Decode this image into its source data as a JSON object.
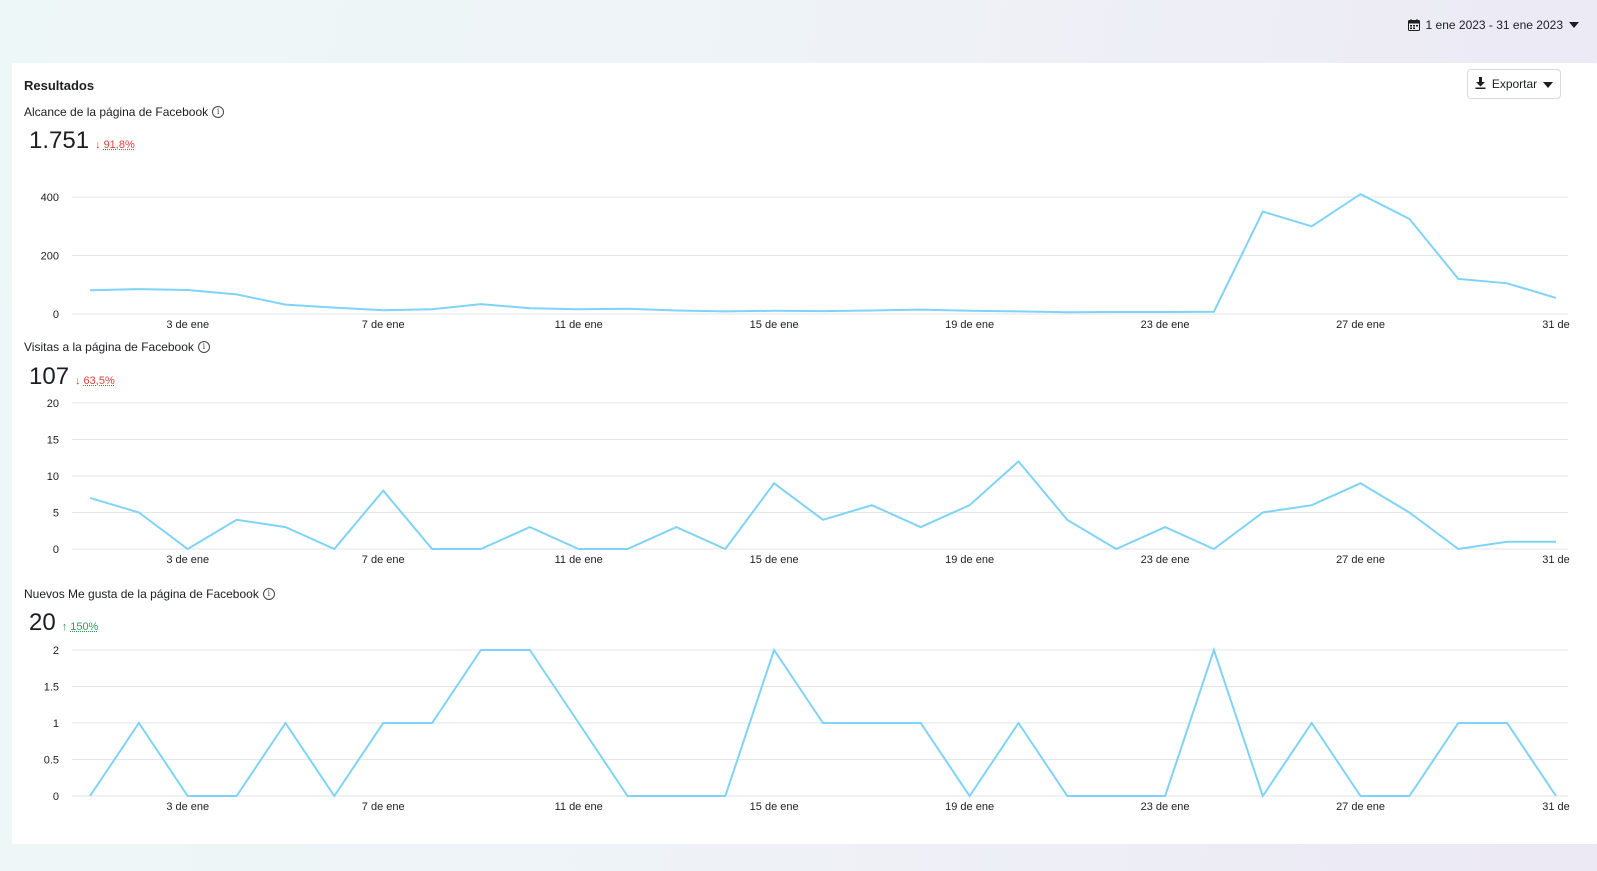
{
  "header": {
    "date_range_label": "1 ene 2023 - 31 ene 2023",
    "calendar_icon": "calendar-icon",
    "caret_icon": "caret-down-icon"
  },
  "results": {
    "title": "Resultados",
    "export_label": "Exportar",
    "export_icon": "download-icon"
  },
  "metrics": [
    {
      "label": "Alcance de la página de Facebook",
      "value": "1.751",
      "delta": "91,8%",
      "direction": "down"
    },
    {
      "label": "Visitas a la página de Facebook",
      "value": "107",
      "delta": "63,5%",
      "direction": "down"
    },
    {
      "label": "Nuevos Me gusta de la página de Facebook",
      "value": "20",
      "delta": "150%",
      "direction": "up"
    }
  ],
  "colors": {
    "line": "#7fd3f7",
    "grid": "#e4e6eb",
    "down": "#e0413b",
    "up": "#2f9e5a"
  },
  "chart_data": [
    {
      "type": "line",
      "name": "Alcance de la página de Facebook",
      "x": [
        1,
        2,
        3,
        4,
        5,
        6,
        7,
        8,
        9,
        10,
        11,
        12,
        13,
        14,
        15,
        16,
        17,
        18,
        19,
        20,
        21,
        22,
        23,
        24,
        25,
        26,
        27,
        28,
        29,
        30,
        31
      ],
      "values": [
        81,
        85,
        82,
        67,
        32,
        22,
        13,
        16,
        34,
        20,
        16,
        18,
        12,
        9,
        11,
        10,
        12,
        15,
        11,
        9,
        6,
        7,
        7,
        8,
        350,
        300,
        410,
        325,
        120,
        105,
        55
      ],
      "yticks": [
        "0",
        "200",
        "400"
      ],
      "ylim": [
        0,
        400
      ],
      "xtick_positions": [
        3,
        7,
        11,
        15,
        19,
        23,
        27,
        31
      ],
      "xtick_labels": [
        "3 de ene",
        "7 de ene",
        "11 de ene",
        "15 de ene",
        "19 de ene",
        "23 de ene",
        "27 de ene",
        "31 de"
      ]
    },
    {
      "type": "line",
      "name": "Visitas a la página de Facebook",
      "x": [
        1,
        2,
        3,
        4,
        5,
        6,
        7,
        8,
        9,
        10,
        11,
        12,
        13,
        14,
        15,
        16,
        17,
        18,
        19,
        20,
        21,
        22,
        23,
        24,
        25,
        26,
        27,
        28,
        29,
        30,
        31
      ],
      "values": [
        7,
        5,
        0,
        4,
        3,
        0,
        8,
        0,
        0,
        3,
        0,
        0,
        3,
        0,
        9,
        4,
        6,
        3,
        6,
        12,
        4,
        0,
        3,
        0,
        5,
        6,
        9,
        5,
        0,
        1,
        1
      ],
      "yticks": [
        "0",
        "5",
        "10",
        "15",
        "20"
      ],
      "ylim": [
        0,
        20
      ],
      "xtick_positions": [
        3,
        7,
        11,
        15,
        19,
        23,
        27,
        31
      ],
      "xtick_labels": [
        "3 de ene",
        "7 de ene",
        "11 de ene",
        "15 de ene",
        "19 de ene",
        "23 de ene",
        "27 de ene",
        "31 de"
      ]
    },
    {
      "type": "line",
      "name": "Nuevos Me gusta de la página de Facebook",
      "x": [
        1,
        2,
        3,
        4,
        5,
        6,
        7,
        8,
        9,
        10,
        11,
        12,
        13,
        14,
        15,
        16,
        17,
        18,
        19,
        20,
        21,
        22,
        23,
        24,
        25,
        26,
        27,
        28,
        29,
        30,
        31
      ],
      "values": [
        0,
        1,
        0,
        0,
        1,
        0,
        1,
        1,
        2,
        2,
        1,
        0,
        0,
        0,
        2,
        1,
        1,
        1,
        0,
        1,
        0,
        0,
        0,
        2,
        0,
        1,
        0,
        0,
        1,
        1,
        0
      ],
      "yticks": [
        "0",
        "0.5",
        "1",
        "1.5",
        "2"
      ],
      "ylim": [
        0,
        2
      ],
      "xtick_positions": [
        3,
        7,
        11,
        15,
        19,
        23,
        27,
        31
      ],
      "xtick_labels": [
        "3 de ene",
        "7 de ene",
        "11 de ene",
        "15 de ene",
        "19 de ene",
        "23 de ene",
        "27 de ene",
        "31 de"
      ]
    }
  ]
}
